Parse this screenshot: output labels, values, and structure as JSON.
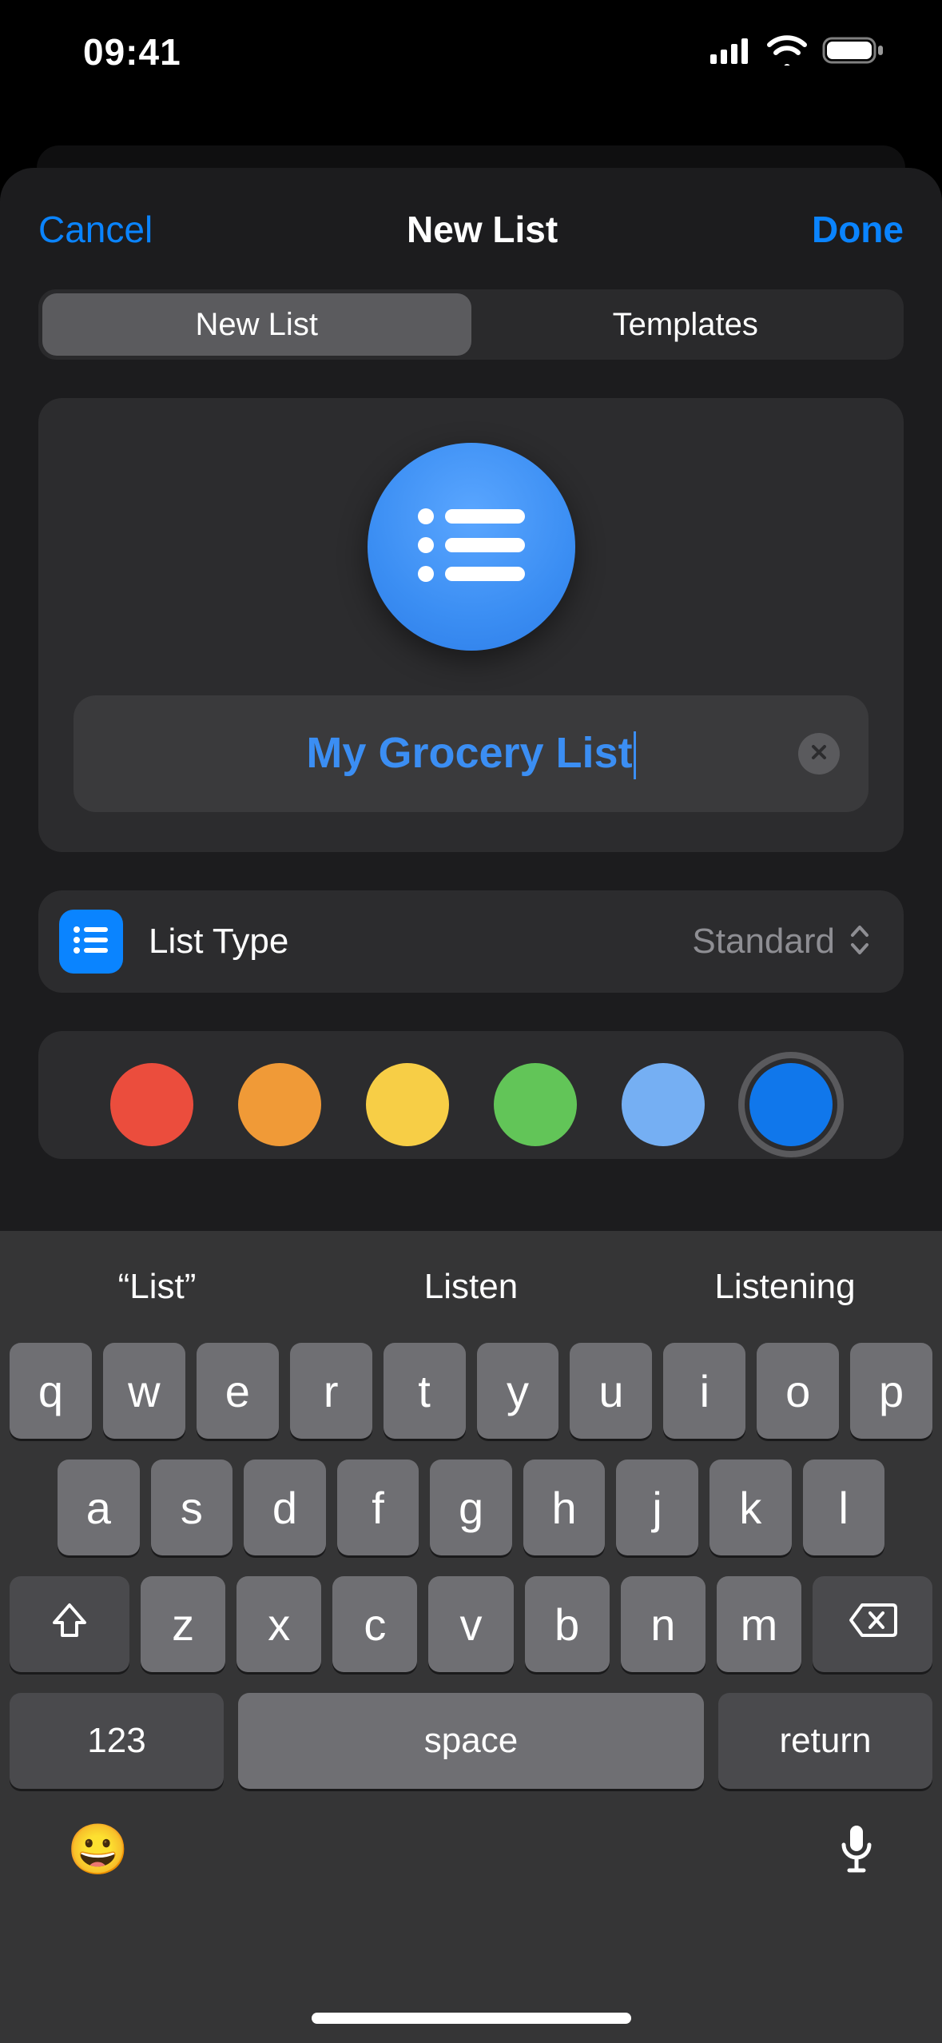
{
  "status_bar": {
    "time": "09:41"
  },
  "nav": {
    "cancel": "Cancel",
    "title": "New List",
    "done": "Done"
  },
  "segments": {
    "new_list": "New List",
    "templates": "Templates"
  },
  "list": {
    "name_value": "My Grocery List",
    "type_label": "List Type",
    "type_value": "Standard"
  },
  "colors": {
    "options": [
      "#eb4d3d",
      "#f09a37",
      "#f7ce46",
      "#62c558",
      "#75aff3",
      "#1077eb"
    ],
    "selected_index": 5
  },
  "keyboard": {
    "suggestions": [
      "“List”",
      "Listen",
      "Listening"
    ],
    "row1": [
      "q",
      "w",
      "e",
      "r",
      "t",
      "y",
      "u",
      "i",
      "o",
      "p"
    ],
    "row2": [
      "a",
      "s",
      "d",
      "f",
      "g",
      "h",
      "j",
      "k",
      "l"
    ],
    "row3": [
      "z",
      "x",
      "c",
      "v",
      "b",
      "n",
      "m"
    ],
    "numkey": "123",
    "space": "space",
    "return": "return"
  }
}
